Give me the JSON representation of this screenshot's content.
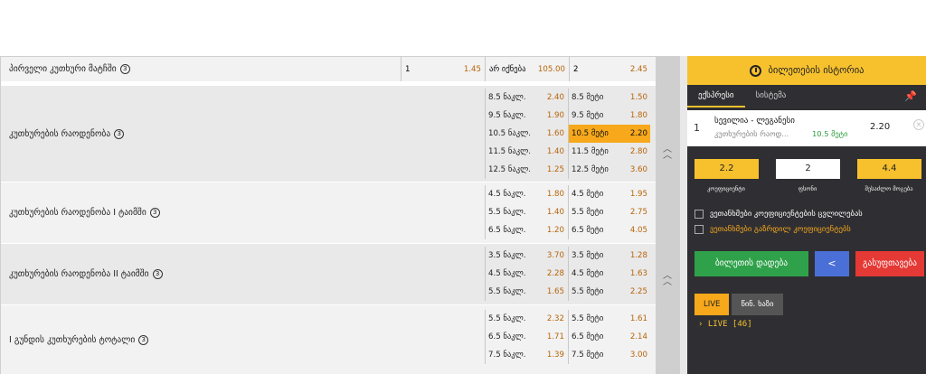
{
  "markets": [
    {
      "name": "პირველი კუთხური მატჩში",
      "info": "3",
      "row": [
        {
          "label": "1",
          "odd": "1.45"
        },
        {
          "label": "არ იქნება",
          "odd": "105.00"
        },
        {
          "label": "2",
          "odd": "2.45"
        }
      ]
    },
    {
      "name": "კუთხურების რაოდენობა",
      "info": "3",
      "under": [
        {
          "label": "8.5 ნაკლ.",
          "odd": "2.40"
        },
        {
          "label": "9.5 ნაკლ.",
          "odd": "1.90"
        },
        {
          "label": "10.5 ნაკლ.",
          "odd": "1.60"
        },
        {
          "label": "11.5 ნაკლ.",
          "odd": "1.40"
        },
        {
          "label": "12.5 ნაკლ.",
          "odd": "1.25"
        }
      ],
      "over": [
        {
          "label": "8.5 მეტი",
          "odd": "1.50"
        },
        {
          "label": "9.5 მეტი",
          "odd": "1.80"
        },
        {
          "label": "10.5 მეტი",
          "odd": "2.20"
        },
        {
          "label": "11.5 მეტი",
          "odd": "2.80"
        },
        {
          "label": "12.5 მეტი",
          "odd": "3.60"
        }
      ]
    },
    {
      "name": "კუთხურების რაოდენობა I ტაიმში",
      "info": "3",
      "under": [
        {
          "label": "4.5 ნაკლ.",
          "odd": "1.80"
        },
        {
          "label": "5.5 ნაკლ.",
          "odd": "1.40"
        },
        {
          "label": "6.5 ნაკლ.",
          "odd": "1.20"
        }
      ],
      "over": [
        {
          "label": "4.5 მეტი",
          "odd": "1.95"
        },
        {
          "label": "5.5 მეტი",
          "odd": "2.75"
        },
        {
          "label": "6.5 მეტი",
          "odd": "4.05"
        }
      ]
    },
    {
      "name": "კუთხურების რაოდენობა II ტაიმში",
      "info": "3",
      "under": [
        {
          "label": "3.5 ნაკლ.",
          "odd": "3.70"
        },
        {
          "label": "4.5 ნაკლ.",
          "odd": "2.28"
        },
        {
          "label": "5.5 ნაკლ.",
          "odd": "1.65"
        }
      ],
      "over": [
        {
          "label": "3.5 მეტი",
          "odd": "1.28"
        },
        {
          "label": "4.5 მეტი",
          "odd": "1.63"
        },
        {
          "label": "5.5 მეტი",
          "odd": "2.25"
        }
      ]
    },
    {
      "name": "I გუნდის კუთხურების ტოტალი",
      "info": "3",
      "under": [
        {
          "label": "5.5 ნაკლ.",
          "odd": "2.32"
        },
        {
          "label": "6.5 ნაკლ.",
          "odd": "1.71"
        },
        {
          "label": "7.5 ნაკლ.",
          "odd": "1.39"
        }
      ],
      "over": [
        {
          "label": "5.5 მეტი",
          "odd": "1.61"
        },
        {
          "label": "6.5 მეტი",
          "odd": "2.14"
        },
        {
          "label": "7.5 მეტი",
          "odd": "3.00"
        }
      ]
    }
  ],
  "betslip": {
    "history_title": "ბილეთების ისტორია",
    "tabs": [
      "ექსპრესი",
      "სისტემა"
    ],
    "bet": {
      "num": "1",
      "match": "სევილია - ლეგანესი",
      "market": "კუთხურების რაოდ...",
      "selection": "10.5 მეტი",
      "odds": "2.20",
      "remove": "×"
    },
    "coef_value": "2.2",
    "stake_value": "2",
    "win_value": "4.4",
    "coef_label": "კოეფიციენტი",
    "stake_label": "ფსონი",
    "win_label": "შესაძლო მოგება",
    "check1": "ვეთანხმები კოეფიციენტების ცვლილებას",
    "check2": "ვეთანხმები გაზრდილ კოეფიციენტებს",
    "btn_bet": "ბილეთის დადება",
    "btn_share": "<",
    "btn_clear": "გასუფთავება",
    "live_tabs": [
      "LIVE",
      "წინ. ხაზი"
    ],
    "live_label": "LIVE [46]",
    "pin": "📌"
  },
  "colors": {
    "accent": "#f7c12e",
    "selected": "#f7a81b",
    "odd": "#b8640a",
    "green": "#2fa14a",
    "blue": "#4a6fd6",
    "red": "#e53935"
  }
}
